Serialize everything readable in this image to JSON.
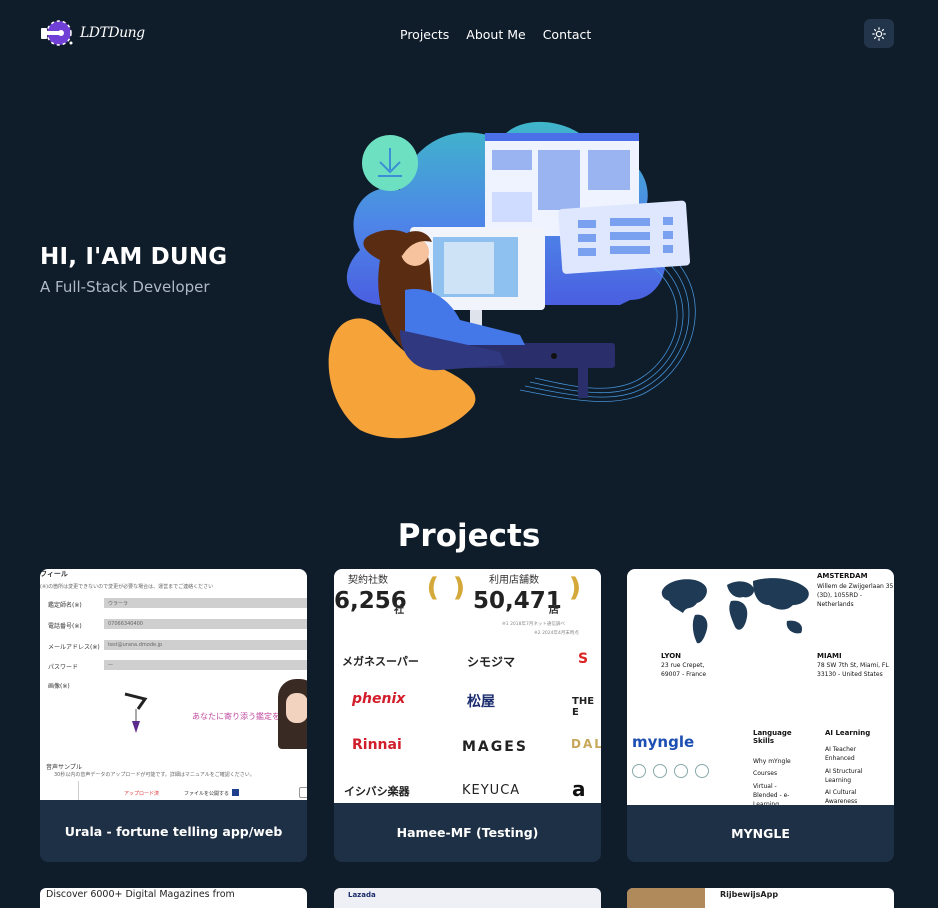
{
  "brand": {
    "name": "LDTDung"
  },
  "nav": {
    "links": [
      "Projects",
      "About Me",
      "Contact"
    ],
    "theme_toggle": "sun-icon"
  },
  "hero": {
    "title": "HI, I'AM DUNG",
    "subtitle": "A Full-Stack Developer"
  },
  "projects": {
    "title": "Projects",
    "cards": [
      {
        "title": "Urala - fortune telling app/web"
      },
      {
        "title": "Hamee-MF (Testing)"
      },
      {
        "title": "MYNGLE"
      }
    ],
    "next_row": [
      "Discover 6000+ Digital Magazines from",
      "Lazada",
      "RijbewijsApp"
    ]
  },
  "urala_thumb": {
    "header": "フィール",
    "note": "(※)の箇所は変更できないので変更が必要な場合は、運営までご連絡ください",
    "fields": [
      {
        "label": "鑑定師名(※)",
        "value": "ウラーラ"
      },
      {
        "label": "電話番号(※)",
        "value": "07066340400"
      },
      {
        "label": "メールアドレス(※)",
        "value": "test@urana.dmode.jp"
      },
      {
        "label": "パスワード",
        "value": "—"
      },
      {
        "label": "画像(※)",
        "value": ""
      }
    ],
    "banner": "あなたに寄り添う鑑定を",
    "sample_title": "音声サンプル",
    "sample_note": "30秒以内の音声データのアップロードが可能です。詳細はマニュアルをご確認ください。",
    "upload": "アップロード済",
    "publish": "ファイルを公開する"
  },
  "hamee_thumb": {
    "stat1_label": "契約社数",
    "stat1_value": "6,256",
    "stat1_unit": "社",
    "stat2_label": "利用店舗数",
    "stat2_value": "50,471",
    "stat2_unit": "店",
    "note1": "※1 2018年7月ネット通信調べ",
    "note2": "※2 2024年4月末時点",
    "brands": [
      "メガネスーパー",
      "シモジマ",
      "phenix",
      "松屋",
      "Rinnai",
      "MAGES",
      "イシバシ楽器",
      "KEYUCA",
      "THE E",
      "DAL"
    ]
  },
  "myngle_thumb": {
    "amsterdam": "AMSTERDAM",
    "amsterdam_addr": "Willem de Zwijgerlaan 35 (3D), 1055RD - Netherlands",
    "lyon": "LYON",
    "lyon_addr": "23 rue Crepet, 69007 - France",
    "miami": "MIAMI",
    "miami_addr": "78 SW 7th St, Miami, FL 33130 - United States",
    "logo": "myngle",
    "col1_title": "Language Skills",
    "col1_items": [
      "Why mYngle",
      "Courses",
      "Virtual - Blended - e-Learning"
    ],
    "col2_title": "AI Learning",
    "col2_items": [
      "AI Teacher Enhanced",
      "AI Structural Learning",
      "AI Cultural Awareness"
    ]
  },
  "colors": {
    "background": "#0f1c2a",
    "card": "#1e3045",
    "accent": "#5b7cf0"
  }
}
